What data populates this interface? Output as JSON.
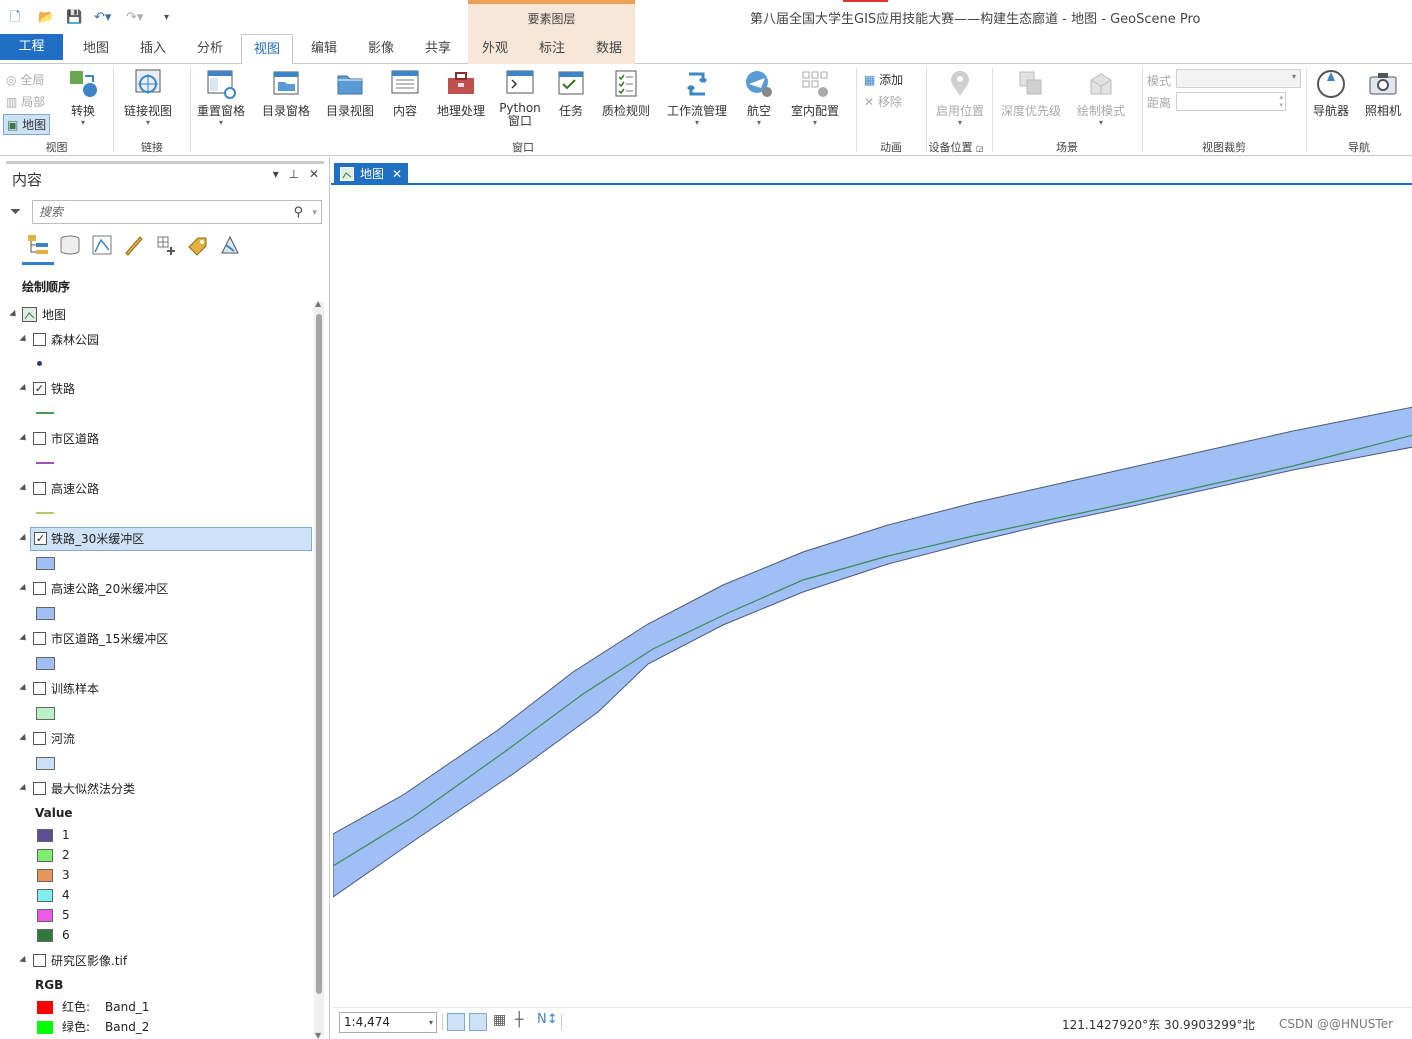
{
  "app": {
    "title": "第八届全国大学生GIS应用技能大赛——构建生态廊道 - 地图 - GeoScene Pro",
    "contextual_group": "要素图层"
  },
  "tabs": [
    {
      "label": "工程",
      "kind": "file"
    },
    {
      "label": "地图"
    },
    {
      "label": "插入"
    },
    {
      "label": "分析"
    },
    {
      "label": "视图",
      "active": true
    },
    {
      "label": "编辑"
    },
    {
      "label": "影像"
    },
    {
      "label": "共享"
    },
    {
      "label": "外观",
      "contextual": true
    },
    {
      "label": "标注",
      "contextual": true
    },
    {
      "label": "数据",
      "contextual": true
    }
  ],
  "ribbon": {
    "view_group": {
      "label": "视图",
      "full": "全局",
      "local": "局部",
      "map": "地图",
      "convert": "转换"
    },
    "link_group": {
      "label": "链接",
      "link_views": "链接视图"
    },
    "window_group": {
      "label": "窗口",
      "reset_panes": "重置窗格",
      "catalog_pane": "目录窗格",
      "catalog_view": "目录视图",
      "contents": "内容",
      "geoprocessing": "地理处理",
      "python_line1": "Python",
      "python_line2": "窗口",
      "tasks": "任务",
      "qa_rules": "质检规则",
      "workflow": "工作流管理",
      "aviation": "航空",
      "indoor": "室内配置"
    },
    "animation_group": {
      "label": "动画",
      "add": "添加",
      "remove": "移除"
    },
    "device_group": {
      "label": "设备位置",
      "enable": "启用位置"
    },
    "scene_group": {
      "label": "场景",
      "depth": "深度优先级",
      "draw_mode": "绘制模式"
    },
    "clip_group": {
      "label": "视图裁剪",
      "mode_label": "模式",
      "distance_label": "距离"
    },
    "nav_group": {
      "label": "导航",
      "navigator": "导航器",
      "camera": "照相机"
    }
  },
  "contents_pane": {
    "title": "内容",
    "search_placeholder": "搜索",
    "drawing_order": "绘制顺序",
    "map_name": "地图",
    "layers": [
      {
        "name": "森林公园",
        "checked": false,
        "symbol": "point",
        "color": "#2e3a7a"
      },
      {
        "name": "铁路",
        "checked": true,
        "symbol": "line",
        "color": "#4a9a55"
      },
      {
        "name": "市区道路",
        "checked": false,
        "symbol": "line",
        "color": "#9b4fb3"
      },
      {
        "name": "高速公路",
        "checked": false,
        "symbol": "line",
        "color": "#b5c86a"
      },
      {
        "name": "铁路_30米缓冲区",
        "checked": true,
        "selected": true,
        "symbol": "fill",
        "color": "#9fbff5"
      },
      {
        "name": "高速公路_20米缓冲区",
        "checked": false,
        "symbol": "fill",
        "color": "#9fbff5"
      },
      {
        "name": "市区道路_15米缓冲区",
        "checked": false,
        "symbol": "fill",
        "color": "#9fbff5"
      },
      {
        "name": "训练样本",
        "checked": false,
        "symbol": "fill",
        "color": "#b9f0c4"
      },
      {
        "name": "河流",
        "checked": false,
        "symbol": "fill",
        "color": "#c9e0f7"
      },
      {
        "name": "最大似然法分类",
        "checked": false,
        "symbol": "classes"
      },
      {
        "name": "研究区影像.tif",
        "checked": false,
        "symbol": "rgb"
      }
    ],
    "classification": {
      "header": "Value",
      "classes": [
        {
          "label": "1",
          "color": "#5c4f96"
        },
        {
          "label": "2",
          "color": "#7ef070"
        },
        {
          "label": "3",
          "color": "#e8955a"
        },
        {
          "label": "4",
          "color": "#7ef0ee"
        },
        {
          "label": "5",
          "color": "#ee5ae8"
        },
        {
          "label": "6",
          "color": "#2f7a3a"
        }
      ]
    },
    "rgb": {
      "header": "RGB",
      "bands": [
        {
          "channel": "红色:",
          "band": "Band_1",
          "color": "#ff0000"
        },
        {
          "channel": "绿色:",
          "band": "Band_2",
          "color": "#00ff00"
        }
      ]
    }
  },
  "map_view": {
    "tab_label": "地图",
    "scale": "1:4,474",
    "coordinates": "121.1427920°东 30.9903299°北",
    "buffer_color": "#9fbff5",
    "railway_color": "#3e8a5a",
    "watermark": "CSDN @@HNUSTer"
  }
}
